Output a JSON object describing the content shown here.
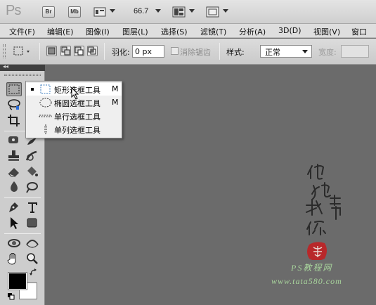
{
  "app": {
    "logo": "Ps",
    "bridge_label": "Br",
    "minibridge_label": "Mb",
    "zoom": "66.7"
  },
  "menu": [
    "文件(F)",
    "编辑(E)",
    "图像(I)",
    "图层(L)",
    "选择(S)",
    "滤镜(T)",
    "分析(A)",
    "3D(D)",
    "视图(V)",
    "窗口"
  ],
  "options": {
    "feather_label": "羽化:",
    "feather_value": "0 px",
    "antialias_label": "消除锯齿",
    "style_label": "样式:",
    "style_value": "正常",
    "width_label": "宽度:"
  },
  "toolbox": {
    "collapse_glyph": "◂◂"
  },
  "flyout": {
    "items": [
      {
        "label": "矩形选框工具",
        "key": "M",
        "icon": "rect-marquee-icon"
      },
      {
        "label": "椭圆选框工具",
        "key": "M",
        "icon": "ellipse-marquee-icon"
      },
      {
        "label": "单行选框工具",
        "key": "",
        "icon": "single-row-marquee-icon"
      },
      {
        "label": "单列选框工具",
        "key": "",
        "icon": "single-column-marquee-icon"
      }
    ]
  },
  "watermark": {
    "calligraphy": "他她我帮你",
    "site_name": "PS教程网",
    "url": "www.tata580.com",
    "colors": {
      "text": "#a8d49c",
      "seal": "#b8282a"
    }
  }
}
